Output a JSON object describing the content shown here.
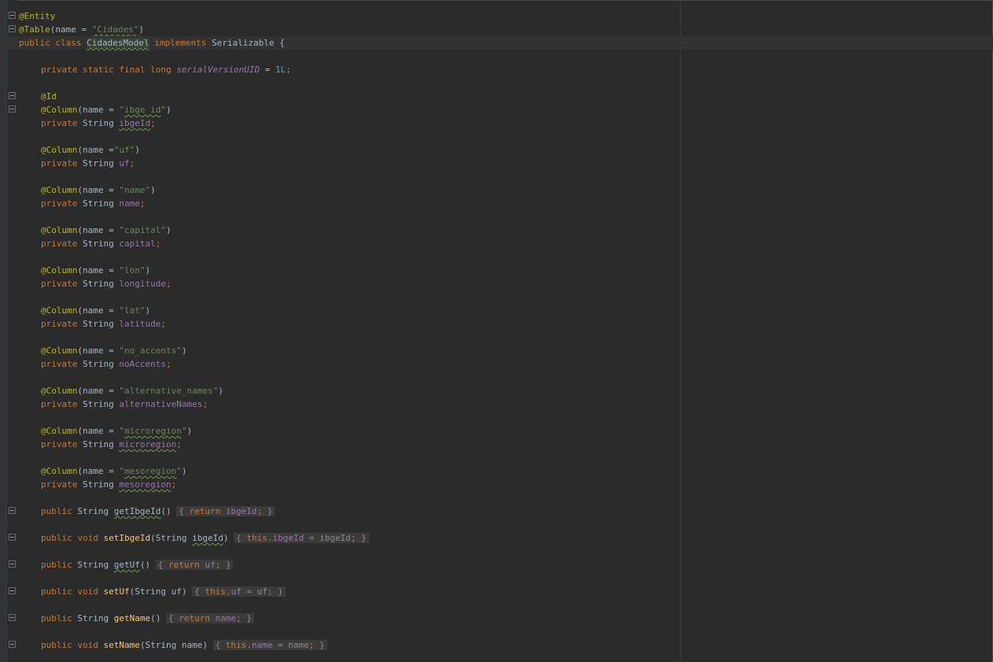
{
  "editor": {
    "language": "Java",
    "theme_colors": {
      "background": "#2b2b2b",
      "keyword": "#cc7832",
      "annotation": "#bbb529",
      "string": "#6a8759",
      "field": "#9876aa",
      "number": "#6897bb",
      "method": "#ffc66d",
      "text": "#a9b7c6"
    }
  },
  "code": {
    "l1": {
      "ann": "@Entity"
    },
    "l2": {
      "ann": "@Table",
      "p1": "(name = ",
      "s": "\"Cidades\"",
      "p2": ")"
    },
    "l3": {
      "kw1": "public class ",
      "cls": "CidadesModel",
      "kw2": " implements ",
      "p1": "Serializable {"
    },
    "l5": {
      "kw": "private static final long ",
      "f": "serialVersionUID",
      "p1": " = ",
      "n": "1L",
      "semi": ";"
    },
    "l7": {
      "ann": "@Id"
    },
    "l8": {
      "ann": "@Column",
      "p1": "(name = ",
      "q1": "\"",
      "sw": "ibge_id",
      "q2": "\"",
      "p2": ")"
    },
    "l9": {
      "kw": "private ",
      "t": "String ",
      "f": "ibgeId",
      "semi": ";"
    },
    "l11": {
      "ann": "@Column",
      "p1": "(name =",
      "s": "\"uf\"",
      "p2": ")"
    },
    "l12": {
      "kw": "private ",
      "t": "String ",
      "f": "uf",
      "semi": ";"
    },
    "l14": {
      "ann": "@Column",
      "p1": "(name = ",
      "s": "\"name\"",
      "p2": ")"
    },
    "l15": {
      "kw": "private ",
      "t": "String ",
      "f": "name",
      "semi": ";"
    },
    "l17": {
      "ann": "@Column",
      "p1": "(name = ",
      "s": "\"capital\"",
      "p2": ")"
    },
    "l18": {
      "kw": "private ",
      "t": "String ",
      "f": "capital",
      "semi": ";"
    },
    "l20": {
      "ann": "@Column",
      "p1": "(name = ",
      "s": "\"lon\"",
      "p2": ")"
    },
    "l21": {
      "kw": "private ",
      "t": "String ",
      "f": "longitude",
      "semi": ";"
    },
    "l23": {
      "ann": "@Column",
      "p1": "(name = ",
      "s": "\"lat\"",
      "p2": ")"
    },
    "l24": {
      "kw": "private ",
      "t": "String ",
      "f": "latitude",
      "semi": ";"
    },
    "l26": {
      "ann": "@Column",
      "p1": "(name = ",
      "s": "\"no_accents\"",
      "p2": ")"
    },
    "l27": {
      "kw": "private ",
      "t": "String ",
      "f": "noAccents",
      "semi": ";"
    },
    "l29": {
      "ann": "@Column",
      "p1": "(name = ",
      "s": "\"alternative_names\"",
      "p2": ")"
    },
    "l30": {
      "kw": "private ",
      "t": "String ",
      "f": "alternativeNames",
      "semi": ";"
    },
    "l32": {
      "ann": "@Column",
      "p1": "(name = ",
      "q1": "\"",
      "sw": "microregion",
      "q2": "\"",
      "p2": ")"
    },
    "l33": {
      "kw": "private ",
      "t": "String ",
      "f": "microregion",
      "semi": ";"
    },
    "l35": {
      "ann": "@Column",
      "p1": "(name = ",
      "q1": "\"",
      "sw": "mesoregion",
      "q2": "\"",
      "p2": ")"
    },
    "l36": {
      "kw": "private ",
      "t": "String ",
      "f": "mesoregion",
      "semi": ";"
    },
    "l38": {
      "kw": "public ",
      "t": "String ",
      "m": "getIbgeId",
      "p1": "() ",
      "ob": "{",
      "kw2": " return ",
      "f": "ibgeId",
      "semi": ";",
      "cb": " }"
    },
    "l40": {
      "kw": "public void ",
      "m": "setIbgeId",
      "p1": "(String ",
      "arg": "ibgeId",
      "p2": ") ",
      "ob": "{",
      "kw2": " this",
      "dot": ".",
      "f": "ibgeId",
      "p3": " = ibgeId",
      "semi": ";",
      "cb": " }"
    },
    "l42": {
      "kw": "public ",
      "t": "String ",
      "m": "getUf",
      "p1": "() ",
      "ob": "{",
      "kw2": " return ",
      "f": "uf",
      "semi": ";",
      "cb": " }"
    },
    "l44": {
      "kw": "public void ",
      "m": "setUf",
      "p1": "(String uf) ",
      "ob": "{",
      "kw2": " this",
      "dot": ".",
      "f": "uf",
      "p3": " = uf",
      "semi": ";",
      "cb": " }"
    },
    "l46": {
      "kw": "public ",
      "t": "String ",
      "m": "getName",
      "p1": "() ",
      "ob": "{",
      "kw2": " return ",
      "f": "name",
      "semi": ";",
      "cb": " }"
    },
    "l48": {
      "kw": "public void ",
      "m": "setName",
      "p1": "(String name) ",
      "ob": "{",
      "kw2": " this",
      "dot": ".",
      "f": "name",
      "p3": " = name",
      "semi": ";",
      "cb": " }"
    }
  }
}
